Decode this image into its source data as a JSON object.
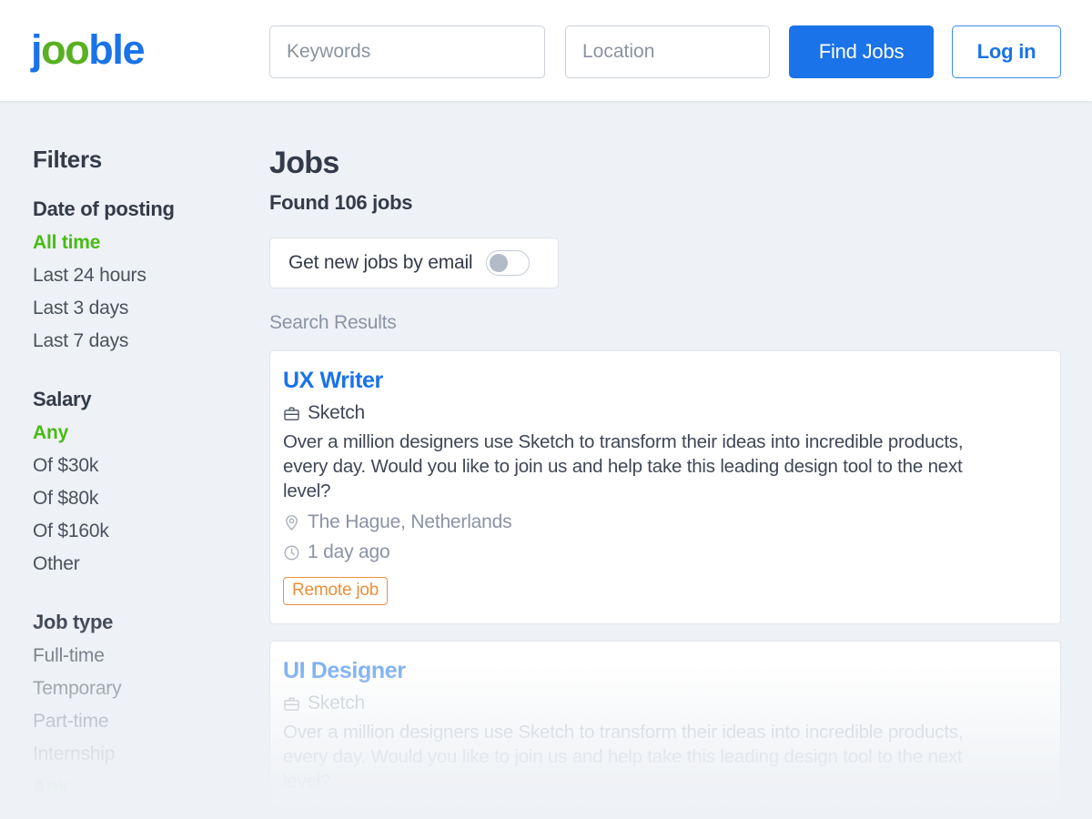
{
  "header": {
    "logo": {
      "part1": "j",
      "part2": "oo",
      "part3": "ble"
    },
    "keywords_placeholder": "Keywords",
    "keywords_value": "",
    "location_placeholder": "Location",
    "location_value": "",
    "find_jobs_label": "Find Jobs",
    "login_label": "Log in",
    "accent_blue": "#1a73e8"
  },
  "sidebar": {
    "title": "Filters",
    "groups": [
      {
        "title": "Date of posting",
        "options": [
          {
            "label": "All time",
            "selected": true
          },
          {
            "label": "Last 24 hours",
            "selected": false
          },
          {
            "label": "Last 3 days",
            "selected": false
          },
          {
            "label": "Last 7 days",
            "selected": false
          }
        ]
      },
      {
        "title": "Salary",
        "options": [
          {
            "label": "Any",
            "selected": true
          },
          {
            "label": "Of $30k",
            "selected": false
          },
          {
            "label": "Of $80k",
            "selected": false
          },
          {
            "label": "Of $160k",
            "selected": false
          },
          {
            "label": "Other",
            "selected": false
          }
        ]
      },
      {
        "title": "Job type",
        "options": [
          {
            "label": "Full-time",
            "selected": false
          },
          {
            "label": "Temporary",
            "selected": false
          },
          {
            "label": "Part-time",
            "selected": false
          },
          {
            "label": "Internship",
            "selected": false
          },
          {
            "label": "Any",
            "selected": true
          }
        ]
      }
    ],
    "selected_color": "#49bb15"
  },
  "main": {
    "page_title": "Jobs",
    "found_count": "Found 106 jobs",
    "email_alert": {
      "label": "Get new jobs by email",
      "enabled": false
    },
    "results_label": "Search Results",
    "jobs": [
      {
        "title": "UX Writer",
        "company": "Sketch",
        "description": "Over a million designers use Sketch to transform their ideas into incredible products, every day. Would you like to join us and help take this leading design tool to the next level?",
        "location": "The Hague, Netherlands",
        "posted": "1 day ago",
        "badge": "Remote job",
        "badge_color": "#ed8f3c",
        "faded": false
      },
      {
        "title": "UI Designer",
        "company": "Sketch",
        "description": "Over a million designers use Sketch to transform their ideas into incredible products, every day. Would you like to join us and help take this leading design tool to the next level?",
        "location": "",
        "posted": "",
        "badge": "",
        "badge_color": "#ed8f3c",
        "faded": true
      }
    ]
  }
}
